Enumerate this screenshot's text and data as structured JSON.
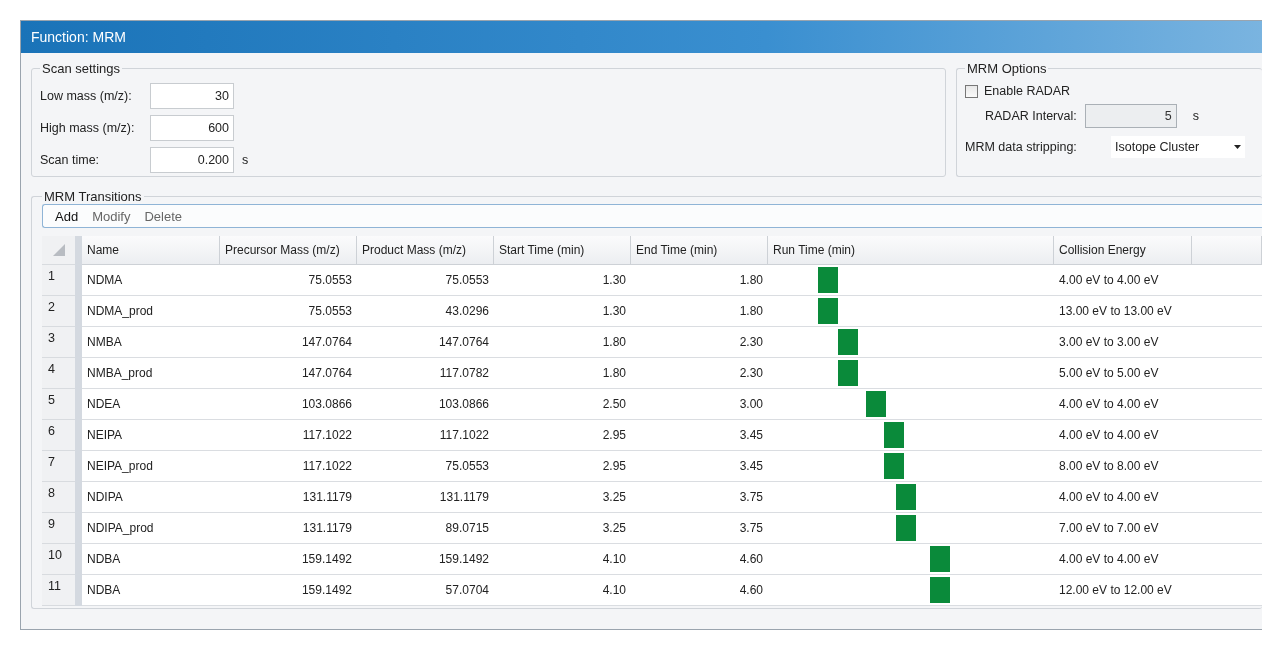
{
  "window": {
    "title": "Function: MRM"
  },
  "scan_settings": {
    "title": "Scan settings",
    "fields": [
      {
        "label": "Low mass (m/z):",
        "value": "30"
      },
      {
        "label": "High mass (m/z):",
        "value": "600"
      },
      {
        "label": "Scan time:",
        "value": "0.200",
        "unit": "s"
      }
    ]
  },
  "mrm_options": {
    "title": "MRM Options",
    "enable_radar": {
      "label": "Enable RADAR",
      "checked": false
    },
    "radar_interval": {
      "label": "RADAR Interval:",
      "value": "5",
      "unit": "s",
      "disabled": true
    },
    "data_stripping": {
      "label": "MRM data stripping:",
      "value": "Isotope Cluster"
    }
  },
  "mrm_transitions": {
    "title": "MRM Transitions",
    "toolbar": [
      {
        "label": "Add",
        "disabled": false
      },
      {
        "label": "Modify",
        "disabled": true
      },
      {
        "label": "Delete",
        "disabled": true
      }
    ],
    "columns": [
      "Name",
      "Precursor Mass (m/z)",
      "Product Mass (m/z)",
      "Start Time (min)",
      "End Time (min)",
      "Run Time (min)",
      "Collision Energy"
    ],
    "rows": [
      {
        "index": "1",
        "name": "NDMA",
        "precursor": "75.0553",
        "product": "75.0553",
        "start": "1.30",
        "end": "1.80",
        "collision": "4.00 eV to 4.00 eV"
      },
      {
        "index": "2",
        "name": "NDMA_prod",
        "precursor": "75.0553",
        "product": "43.0296",
        "start": "1.30",
        "end": "1.80",
        "collision": "13.00 eV to 13.00 eV"
      },
      {
        "index": "3",
        "name": "NMBA",
        "precursor": "147.0764",
        "product": "147.0764",
        "start": "1.80",
        "end": "2.30",
        "collision": "3.00 eV to 3.00 eV"
      },
      {
        "index": "4",
        "name": "NMBA_prod",
        "precursor": "147.0764",
        "product": "117.0782",
        "start": "1.80",
        "end": "2.30",
        "collision": "5.00 eV to 5.00 eV"
      },
      {
        "index": "5",
        "name": "NDEA",
        "precursor": "103.0866",
        "product": "103.0866",
        "start": "2.50",
        "end": "3.00",
        "collision": "4.00 eV to 4.00 eV"
      },
      {
        "index": "6",
        "name": "NEIPA",
        "precursor": "117.1022",
        "product": "117.1022",
        "start": "2.95",
        "end": "3.45",
        "collision": "4.00 eV to 4.00 eV"
      },
      {
        "index": "7",
        "name": "NEIPA_prod",
        "precursor": "117.1022",
        "product": "75.0553",
        "start": "2.95",
        "end": "3.45",
        "collision": "8.00 eV to 8.00 eV"
      },
      {
        "index": "8",
        "name": "NDIPA",
        "precursor": "131.1179",
        "product": "131.1179",
        "start": "3.25",
        "end": "3.75",
        "collision": "4.00 eV to 4.00 eV"
      },
      {
        "index": "9",
        "name": "NDIPA_prod",
        "precursor": "131.1179",
        "product": "89.0715",
        "start": "3.25",
        "end": "3.75",
        "collision": "7.00 eV to 7.00 eV"
      },
      {
        "index": "10",
        "name": "NDBA",
        "precursor": "159.1492",
        "product": "159.1492",
        "start": "4.10",
        "end": "4.60",
        "collision": "4.00 eV to 4.00 eV"
      },
      {
        "index": "11",
        "name": "NDBA",
        "precursor": "159.1492",
        "product": "57.0704",
        "start": "4.10",
        "end": "4.60",
        "collision": "12.00 eV to 12.00 eV"
      }
    ]
  }
}
